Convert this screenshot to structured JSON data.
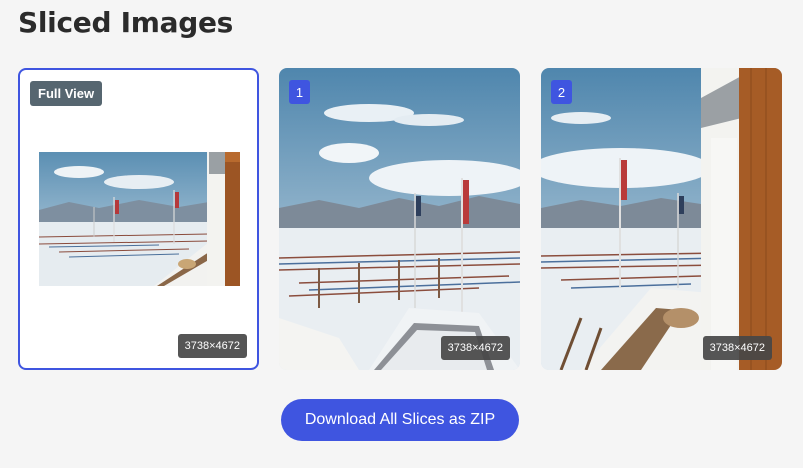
{
  "page": {
    "title": "Sliced Images"
  },
  "cards": [
    {
      "badge": "Full View",
      "dimensions": "3738×4672"
    },
    {
      "badge": "1",
      "dimensions": "3738×4672"
    },
    {
      "badge": "2",
      "dimensions": "3738×4672"
    }
  ],
  "actions": {
    "download_label": "Download All Slices as ZIP"
  },
  "colors": {
    "accent": "#3f55e0",
    "badge_gray": "#566670"
  }
}
